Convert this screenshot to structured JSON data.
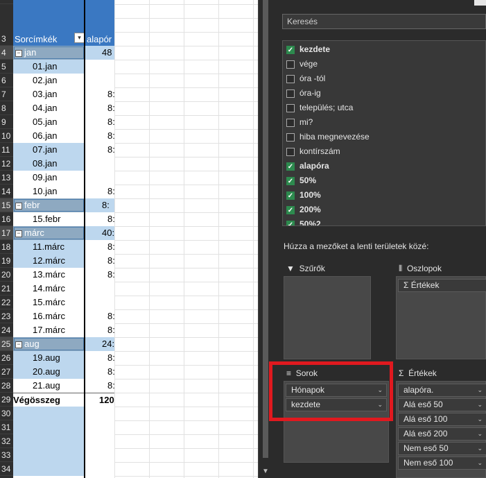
{
  "sheet": {
    "header_row_number": "3",
    "col_a_header": "Sorcímkék",
    "col_b_header": "alapór",
    "rows": [
      {
        "n": "4",
        "a": "jan",
        "b": "48",
        "type": "group"
      },
      {
        "n": "5",
        "a": "01.jan",
        "b": "",
        "type": "light"
      },
      {
        "n": "6",
        "a": "02.jan",
        "b": "",
        "type": "plain"
      },
      {
        "n": "7",
        "a": "03.jan",
        "b": "8:",
        "type": "plain"
      },
      {
        "n": "8",
        "a": "04.jan",
        "b": "8:",
        "type": "plain"
      },
      {
        "n": "9",
        "a": "05.jan",
        "b": "8:",
        "type": "plain"
      },
      {
        "n": "10",
        "a": "06.jan",
        "b": "8:",
        "type": "plain"
      },
      {
        "n": "11",
        "a": "07.jan",
        "b": "8:",
        "type": "light"
      },
      {
        "n": "12",
        "a": "08.jan",
        "b": "",
        "type": "light"
      },
      {
        "n": "13",
        "a": "09.jan",
        "b": "",
        "type": "plain"
      },
      {
        "n": "14",
        "a": "10.jan",
        "b": "8:",
        "type": "plain"
      },
      {
        "n": "15",
        "a": "febr",
        "b": "8:",
        "type": "group"
      },
      {
        "n": "16",
        "a": "15.febr",
        "b": "8:",
        "type": "plain"
      },
      {
        "n": "17",
        "a": "márc",
        "b": "40:",
        "type": "group"
      },
      {
        "n": "18",
        "a": "11.márc",
        "b": "8:",
        "type": "light"
      },
      {
        "n": "19",
        "a": "12.márc",
        "b": "8:",
        "type": "light"
      },
      {
        "n": "20",
        "a": "13.márc",
        "b": "8:",
        "type": "plain"
      },
      {
        "n": "21",
        "a": "14.márc",
        "b": "",
        "type": "plain"
      },
      {
        "n": "22",
        "a": "15.márc",
        "b": "",
        "type": "plain"
      },
      {
        "n": "23",
        "a": "16.márc",
        "b": "8:",
        "type": "plain"
      },
      {
        "n": "24",
        "a": "17.márc",
        "b": "8:",
        "type": "plain"
      },
      {
        "n": "25",
        "a": "aug",
        "b": "24:",
        "type": "group"
      },
      {
        "n": "26",
        "a": "19.aug",
        "b": "8:",
        "type": "light"
      },
      {
        "n": "27",
        "a": "20.aug",
        "b": "8:",
        "type": "light"
      },
      {
        "n": "28",
        "a": "21.aug",
        "b": "8:",
        "type": "plain"
      },
      {
        "n": "29",
        "a": "Végösszeg",
        "b": "120:",
        "type": "total"
      },
      {
        "n": "30",
        "a": "",
        "b": "",
        "type": "empty"
      },
      {
        "n": "31",
        "a": "",
        "b": "",
        "type": "empty"
      },
      {
        "n": "32",
        "a": "",
        "b": "",
        "type": "empty"
      },
      {
        "n": "33",
        "a": "",
        "b": "",
        "type": "empty"
      },
      {
        "n": "34",
        "a": "",
        "b": "",
        "type": "empty"
      }
    ]
  },
  "pane": {
    "search_placeholder": "Keresés",
    "fields": [
      {
        "label": "kezdete",
        "checked": true
      },
      {
        "label": "vége",
        "checked": false
      },
      {
        "label": "óra -tól",
        "checked": false
      },
      {
        "label": "óra-ig",
        "checked": false
      },
      {
        "label": "település; utca",
        "checked": false
      },
      {
        "label": "mi?",
        "checked": false
      },
      {
        "label": "hiba megnevezése",
        "checked": false
      },
      {
        "label": "kontírszám",
        "checked": false
      },
      {
        "label": "alapóra",
        "checked": true
      },
      {
        "label": "50%",
        "checked": true
      },
      {
        "label": "100%",
        "checked": true
      },
      {
        "label": "200%",
        "checked": true
      },
      {
        "label": "50%2",
        "checked": true
      }
    ],
    "hint": "Húzza a mezőket a lenti területek közé:",
    "filters_title": "Szűrők",
    "columns_title": "Oszlopok",
    "columns_items": [
      "Értékek"
    ],
    "rows_title": "Sorok",
    "rows_items": [
      "Hónapok",
      "kezdete"
    ],
    "values_title": "Értékek",
    "values_items": [
      "alapóra.",
      "Alá eső 50",
      "Alá eső 100",
      "Alá eső 200",
      "Nem eső 50",
      "Nem eső 100"
    ]
  },
  "colors": {
    "highlight": "#e0191f",
    "checkbox": "#2d8a4e",
    "header_blue": "#3a78c2",
    "light_blue": "#bdd7ee"
  }
}
